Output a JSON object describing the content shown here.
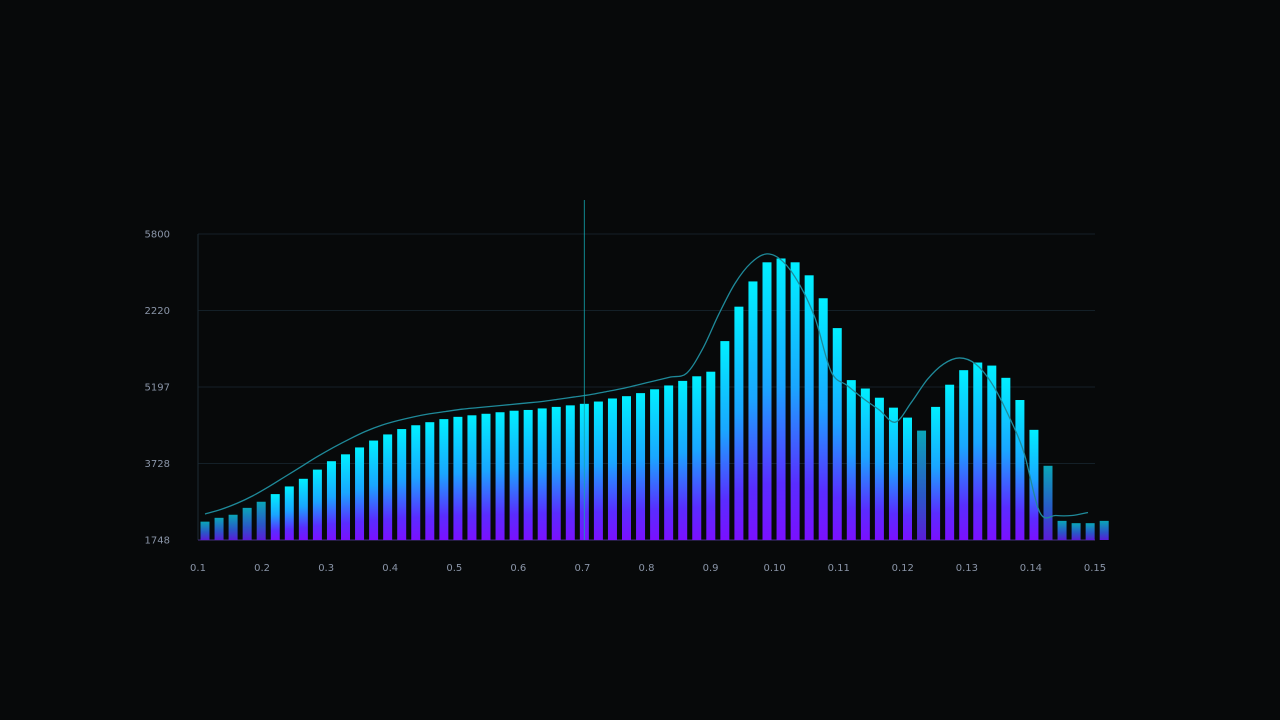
{
  "chart_data": {
    "type": "bar",
    "title": "",
    "xlabel": "",
    "ylabel": "",
    "y_tick_labels": [
      "5800",
      "2220",
      "5197",
      "3728",
      "1748"
    ],
    "x_tick_labels": [
      "0.1",
      "0.2",
      "0.3",
      "0.4",
      "0.5",
      "0.6",
      "0.7",
      "0.8",
      "0.9",
      "0.10",
      "0.11",
      "0.12",
      "0.13",
      "0.14",
      "0.15"
    ],
    "ylim": [
      0,
      4
    ],
    "grid": true,
    "cursor_x_index": 27,
    "values": [
      0.24,
      0.29,
      0.33,
      0.42,
      0.5,
      0.6,
      0.7,
      0.8,
      0.92,
      1.03,
      1.12,
      1.21,
      1.3,
      1.38,
      1.45,
      1.5,
      1.54,
      1.58,
      1.61,
      1.63,
      1.65,
      1.67,
      1.69,
      1.7,
      1.72,
      1.74,
      1.76,
      1.78,
      1.81,
      1.85,
      1.88,
      1.92,
      1.97,
      2.02,
      2.08,
      2.14,
      2.2,
      2.6,
      3.05,
      3.38,
      3.63,
      3.68,
      3.63,
      3.46,
      3.16,
      2.77,
      2.09,
      1.98,
      1.86,
      1.73,
      1.6,
      1.43,
      1.74,
      2.03,
      2.22,
      2.32,
      2.28,
      2.12,
      1.83,
      1.44,
      0.97,
      0.25,
      0.22,
      0.22,
      0.25
    ],
    "trend": [
      0.34,
      0.4,
      0.48,
      0.58,
      0.7,
      0.83,
      0.96,
      1.09,
      1.21,
      1.32,
      1.42,
      1.5,
      1.56,
      1.61,
      1.65,
      1.68,
      1.71,
      1.73,
      1.75,
      1.77,
      1.79,
      1.81,
      1.84,
      1.87,
      1.9,
      1.94,
      1.98,
      2.03,
      2.08,
      2.13,
      2.18,
      2.5,
      2.95,
      3.35,
      3.62,
      3.74,
      3.64,
      3.35,
      2.9,
      2.2,
      2.02,
      1.85,
      1.7,
      1.54,
      1.8,
      2.1,
      2.3,
      2.38,
      2.3,
      2.05,
      1.65,
      1.15,
      0.36,
      0.32,
      0.32,
      0.36
    ]
  }
}
